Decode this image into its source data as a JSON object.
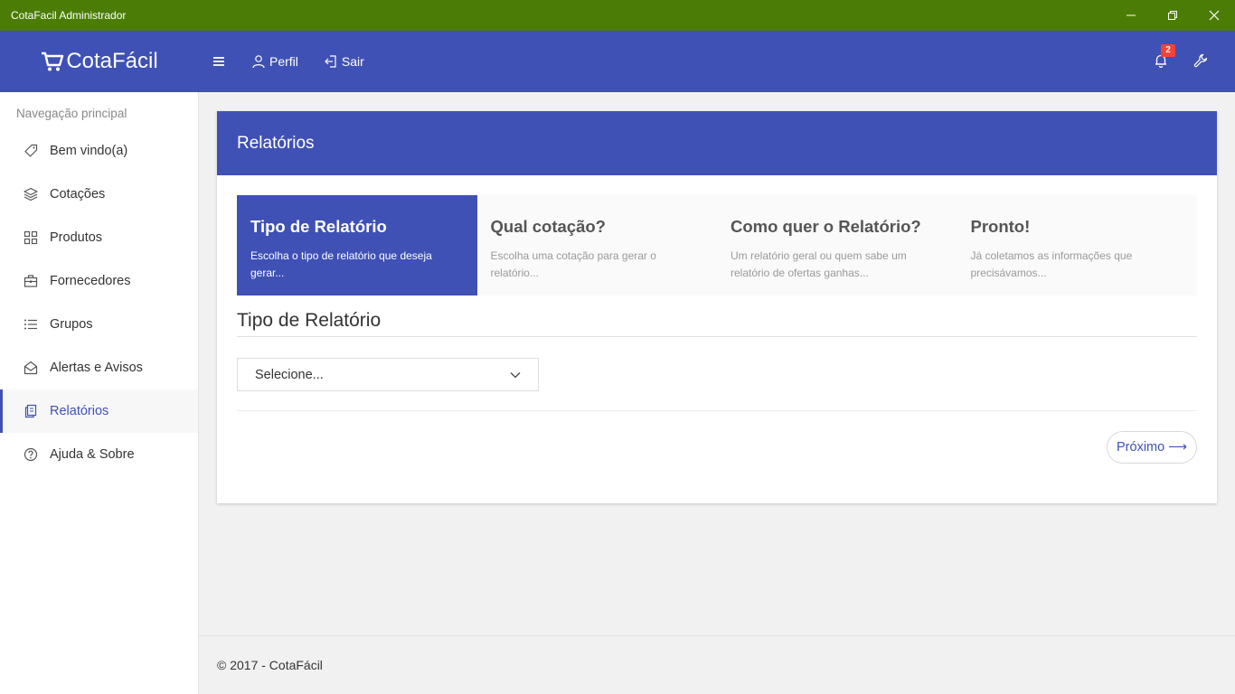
{
  "window": {
    "title": "CotaFacil Administrador"
  },
  "appbar": {
    "brand": "CotaFácil",
    "nav": [
      {
        "label": "Perfil",
        "icon": "user-icon"
      },
      {
        "label": "Sair",
        "icon": "logout-icon"
      }
    ],
    "notifications_count": "2",
    "colors": {
      "titlebar": "#4b7d06",
      "primary": "#3f51b5",
      "badge": "#f44336"
    }
  },
  "sidebar": {
    "section_title": "Navegação principal",
    "items": [
      {
        "label": "Bem vindo(a)",
        "icon": "tag-icon"
      },
      {
        "label": "Cotações",
        "icon": "layers-icon"
      },
      {
        "label": "Produtos",
        "icon": "grid-icon"
      },
      {
        "label": "Fornecedores",
        "icon": "briefcase-icon"
      },
      {
        "label": "Grupos",
        "icon": "list-icon"
      },
      {
        "label": "Alertas e Avisos",
        "icon": "envelope-icon"
      },
      {
        "label": "Relatórios",
        "icon": "documents-icon",
        "active": true
      },
      {
        "label": "Ajuda & Sobre",
        "icon": "help-circle-icon"
      }
    ]
  },
  "page": {
    "title": "Relatórios",
    "steps": [
      {
        "title": "Tipo de Relatório",
        "desc": "Escolha o tipo de relatório que deseja gerar...",
        "active": true
      },
      {
        "title": "Qual cotação?",
        "desc": "Escolha uma cotação para gerar o relatório..."
      },
      {
        "title": "Como quer o Relatório?",
        "desc": "Um relatório geral ou quem sabe um relatório de ofertas ganhas..."
      },
      {
        "title": "Pronto!",
        "desc": "Já coletamos as informações que precisávamos..."
      }
    ],
    "section_title": "Tipo de Relatório",
    "select_value": "Selecione...",
    "next_label": "Próximo",
    "next_arrow": "⟶"
  },
  "footer": {
    "text": "© 2017 - CotaFácil"
  }
}
